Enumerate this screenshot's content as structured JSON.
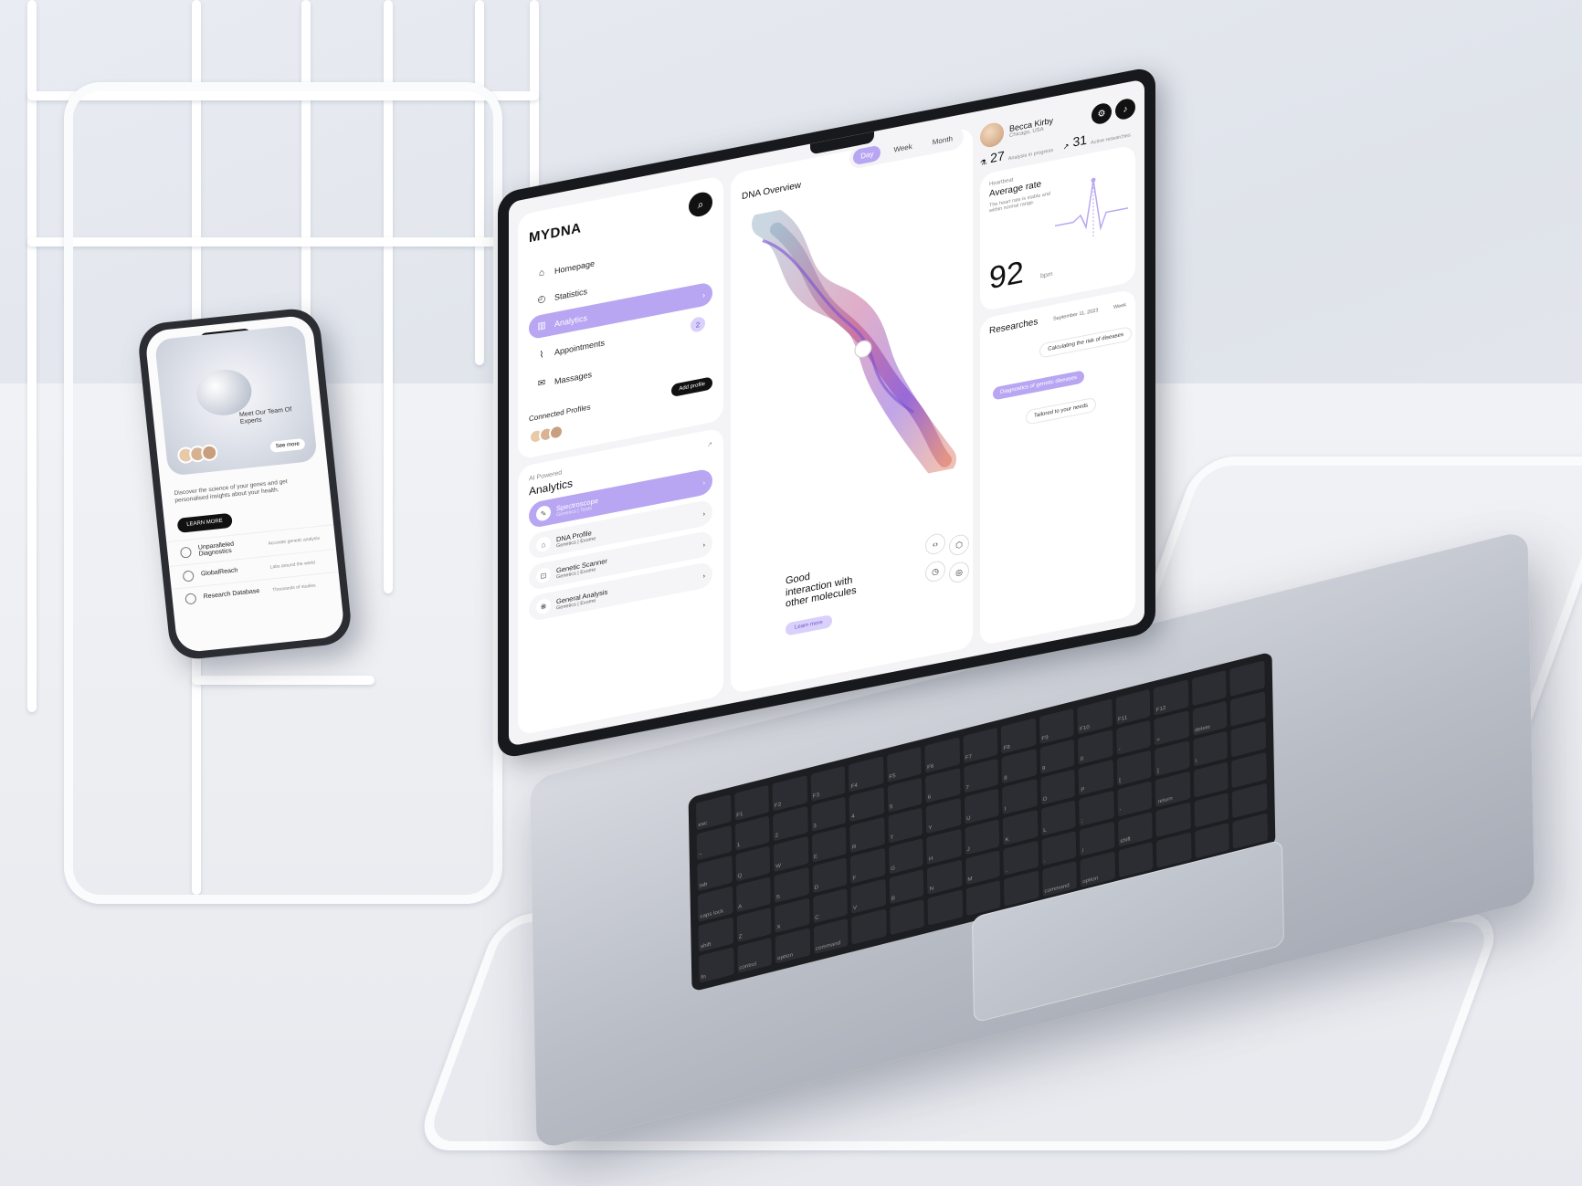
{
  "phone": {
    "hero_text": "Meet Our Team Of Experts",
    "hero_button": "See more",
    "body_text": "Discover the science of your genes and get personalised insights about your health.",
    "cta": "LEARN MORE",
    "rows": [
      {
        "label": "Unparalleled Diagnostics",
        "desc": "Accurate genetic analysis"
      },
      {
        "label": "GlobalReach",
        "desc": "Labs around the world"
      },
      {
        "label": "Research Database",
        "desc": "Thousands of studies"
      }
    ]
  },
  "sidebar": {
    "brand": "MYDNA",
    "search_icon": "search-icon",
    "items": [
      {
        "label": "Homepage",
        "icon": "home-icon"
      },
      {
        "label": "Statistics",
        "icon": "chart-icon"
      },
      {
        "label": "Analytics",
        "icon": "analytics-icon",
        "active": true
      },
      {
        "label": "Appointments",
        "icon": "paperclip-icon",
        "badge": "2"
      },
      {
        "label": "Massages",
        "icon": "mail-icon"
      }
    ],
    "connected_label": "Connected Profiles",
    "add_button": "Add profile"
  },
  "ai": {
    "tag": "AI Powered",
    "title": "Analytics",
    "tools": [
      {
        "label": "Spectroscope",
        "sub": "Genetics | Tests",
        "active": true
      },
      {
        "label": "DNA Profile",
        "sub": "Genetics | Exome"
      },
      {
        "label": "Genetic Scanner",
        "sub": "Genetics | Exome"
      },
      {
        "label": "General Analysis",
        "sub": "Genetics | Exome"
      }
    ]
  },
  "main": {
    "title": "DNA Overview",
    "tabs": [
      "Day",
      "Week",
      "Month"
    ],
    "active_tab": "Day",
    "good_text": "Good interaction with other molecules",
    "learn_button": "Learn more"
  },
  "profile": {
    "name": "Becca Kirby",
    "location": "Chicago, USA",
    "stats": [
      {
        "value": "27",
        "label": "Analysis in progress"
      },
      {
        "value": "31",
        "label": "Active researches"
      }
    ]
  },
  "rate": {
    "tag": "Heartbeat",
    "title": "Average rate",
    "desc": "The heart rate is stable and within normal range.",
    "value": "92",
    "unit": "bpm"
  },
  "research": {
    "title": "Researches",
    "date": "September 11, 2023",
    "filter": "Week",
    "pills": [
      "Calculating the risk of diseases",
      "Diagnostics of genetic diseases",
      "Tailored to your needs"
    ]
  },
  "keyboard": {
    "keys": [
      "esc",
      "F1",
      "F2",
      "F3",
      "F4",
      "F5",
      "F6",
      "F7",
      "F8",
      "F9",
      "F10",
      "F11",
      "F12",
      "",
      "",
      "~",
      "1",
      "2",
      "3",
      "4",
      "5",
      "6",
      "7",
      "8",
      "9",
      "0",
      "-",
      "=",
      "delete",
      "",
      "tab",
      "Q",
      "W",
      "E",
      "R",
      "T",
      "Y",
      "U",
      "I",
      "O",
      "P",
      "[",
      "]",
      "\\",
      "",
      "caps lock",
      "A",
      "S",
      "D",
      "F",
      "G",
      "H",
      "J",
      "K",
      "L",
      ";",
      "'",
      "return",
      "",
      "",
      "shift",
      "Z",
      "X",
      "C",
      "V",
      "B",
      "N",
      "M",
      ",",
      ".",
      "/",
      "shift",
      "",
      "",
      "",
      "fn",
      "control",
      "option",
      "command",
      "",
      "",
      "",
      "",
      "",
      "command",
      "option",
      "",
      "",
      "",
      ""
    ]
  },
  "colors": {
    "accent": "#b8a6f2",
    "accent_light": "#d9d0fb",
    "dark": "#111111"
  }
}
